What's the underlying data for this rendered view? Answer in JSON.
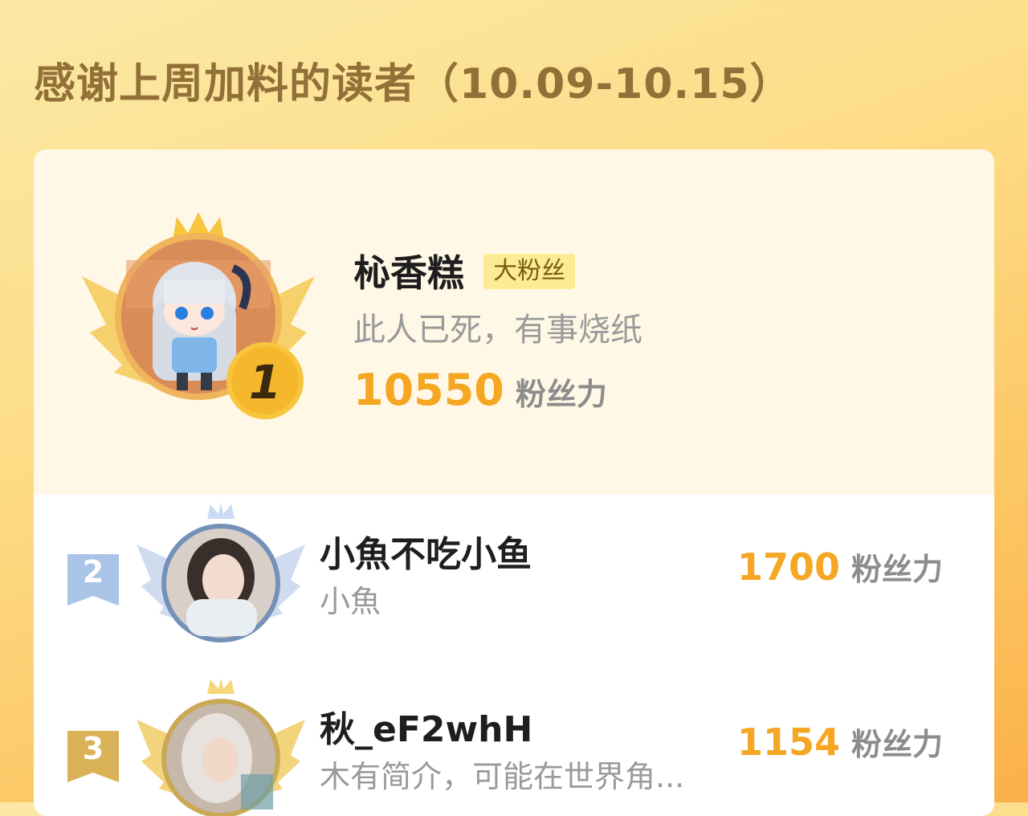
{
  "header": {
    "title": "感谢上周加料的读者（10.09-10.15）"
  },
  "leaderboard": {
    "score_unit": "粉丝力",
    "top": {
      "rank": "1",
      "name": "杺香糕",
      "badge": "大粉丝",
      "bio": "此人已死，有事烧纸",
      "score": "10550"
    },
    "rows": [
      {
        "rank": "2",
        "name": "小魚不吃小鱼",
        "bio": "小魚",
        "score": "1700"
      },
      {
        "rank": "3",
        "name": "秋_eF2whH",
        "bio": "木有简介，可能在世界角...",
        "score": "1154"
      }
    ]
  },
  "colors": {
    "accent_score": "#f5a623",
    "title": "#937038",
    "gold": "#f7c63e",
    "silver_blue": "#a9c4e6"
  }
}
